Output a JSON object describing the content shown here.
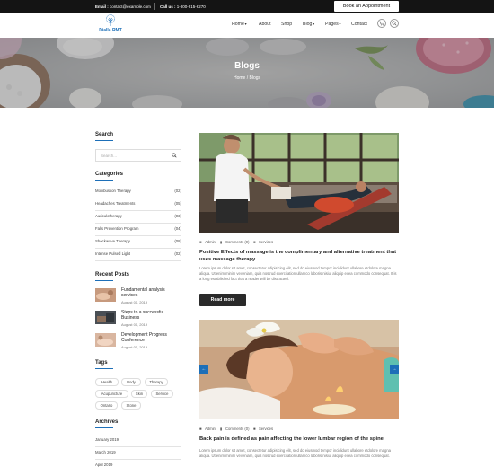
{
  "topbar": {
    "email_label": "Email :",
    "email": "contact@example.com",
    "phone_label": "Call us :",
    "phone": "1-800-915-6270",
    "appointment_button": "Book an Appointment"
  },
  "header": {
    "logo_text": "Dialla RMT",
    "nav": [
      {
        "label": "Home",
        "has_dropdown": true
      },
      {
        "label": "About",
        "has_dropdown": false
      },
      {
        "label": "Shop",
        "has_dropdown": false
      },
      {
        "label": "Blog",
        "has_dropdown": true
      },
      {
        "label": "Pages",
        "has_dropdown": true
      },
      {
        "label": "Contact",
        "has_dropdown": false
      }
    ],
    "icons": [
      "cart-icon",
      "search-icon"
    ]
  },
  "hero": {
    "title": "Blogs",
    "breadcrumb_home": "Home",
    "breadcrumb_sep": "/",
    "breadcrumb_current": "Blogs"
  },
  "sidebar": {
    "search": {
      "heading": "Search",
      "placeholder": "Search..."
    },
    "categories": {
      "heading": "Categories",
      "items": [
        {
          "name": "Moxibustion Therapy",
          "count": "(02)"
        },
        {
          "name": "Headaches Treatments",
          "count": "(05)"
        },
        {
          "name": "Auriculotherapy",
          "count": "(03)"
        },
        {
          "name": "Falls Prevention Program",
          "count": "(04)"
        },
        {
          "name": "Shockwave Therapy",
          "count": "(08)"
        },
        {
          "name": "Intense Pulsed Light",
          "count": "(02)"
        }
      ]
    },
    "recent_posts": {
      "heading": "Recent Posts",
      "items": [
        {
          "title": "Fundamental analysis services",
          "date": "August 01, 2019"
        },
        {
          "title": "Steps to a successful Business",
          "date": "August 01, 2019"
        },
        {
          "title": "Development Progress Conference",
          "date": "August 01, 2019"
        }
      ]
    },
    "tags": {
      "heading": "Tags",
      "items": [
        "Health",
        "Body",
        "Therapy",
        "Acupuncture",
        "Skin",
        "Service",
        "Ontario",
        "Stone"
      ]
    },
    "archives": {
      "heading": "Archives",
      "items": [
        "January 2019",
        "March 2019",
        "April 2019"
      ]
    }
  },
  "posts": [
    {
      "author": "Admin",
      "comments": "Comments (0)",
      "category": "Services",
      "title": "Positive Effects of massage is the complimentary and alternative treatment that uses massage therapy",
      "excerpt": "Lorem ipsum dolor sit amet, consectetur adipisicing elit, sed do eiusmod tempor incididunt ullabore etdolore magna aliqua. Ut enim minim veveniam, quis nostrud exercitation ullamco laboris nisiut aliquip exea commodo consequat. It is a long established fact that a reader will be distracted.",
      "button": "Read more"
    },
    {
      "author": "Admin",
      "comments": "Comments (0)",
      "category": "Services",
      "title": "Back pain is defined as pain affecting the lower lumbar region of the spine",
      "excerpt": "Lorem ipsum dolor sit amet, consectetur adipisicing elit, sed do eiusmod tempor incididunt ullabore etdolore magna aliqua. Ut enim minim veveniam, quis nostrud exercitation ullamco laboris nisiut aliquip exea commodo consequat.",
      "slider_prev": "←",
      "slider_next": "→"
    }
  ],
  "colors": {
    "accent": "#1d6fb8",
    "dark": "#141414",
    "button": "#2a2a2a"
  }
}
